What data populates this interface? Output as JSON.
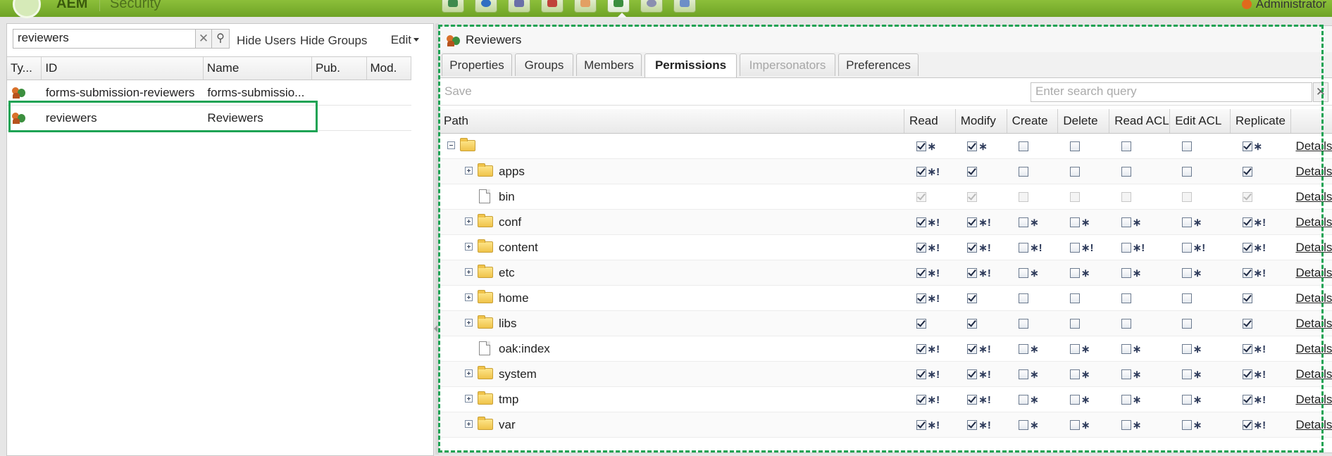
{
  "header": {
    "brand": "AEM",
    "section": "Security",
    "user": "Administrator",
    "toolbar_icons": [
      "websites-icon",
      "globe-icon",
      "dam-icon",
      "tools-icon",
      "inbox-icon",
      "users-icon",
      "workflow-icon",
      "tag-icon"
    ]
  },
  "left": {
    "search_value": "reviewers",
    "clear": "✕",
    "search_glyph": "⚲",
    "hide_users": "Hide Users",
    "hide_groups": "Hide Groups",
    "edit": "Edit",
    "columns": [
      "Ty...",
      "ID",
      "Name",
      "Pub.",
      "Mod."
    ],
    "rows": [
      {
        "id": "forms-submission-reviewers",
        "name": "forms-submissio..."
      },
      {
        "id": "reviewers",
        "name": "Reviewers"
      }
    ]
  },
  "right": {
    "title": "Reviewers",
    "tabs": [
      "Properties",
      "Groups",
      "Members",
      "Permissions",
      "Impersonators",
      "Preferences"
    ],
    "active_tab": "Permissions",
    "save": "Save",
    "search_placeholder": "Enter search query",
    "search_clear": "✕",
    "columns": [
      "Path",
      "Read",
      "Modify",
      "Create",
      "Delete",
      "Read ACL",
      "Edit ACL",
      "Replicate",
      ""
    ],
    "details_label": "Details",
    "rows": [
      {
        "path": "",
        "root": true,
        "perms": [
          [
            1,
            "∗"
          ],
          [
            1,
            "∗"
          ],
          [
            0,
            ""
          ],
          [
            0,
            ""
          ],
          [
            0,
            ""
          ],
          [
            0,
            ""
          ],
          [
            1,
            "∗"
          ]
        ]
      },
      {
        "path": "apps",
        "perms": [
          [
            1,
            "∗!"
          ],
          [
            1,
            ""
          ],
          [
            0,
            ""
          ],
          [
            0,
            ""
          ],
          [
            0,
            ""
          ],
          [
            0,
            ""
          ],
          [
            1,
            ""
          ]
        ]
      },
      {
        "path": "bin",
        "file": true,
        "disabled": true,
        "perms": [
          [
            1,
            ""
          ],
          [
            1,
            ""
          ],
          [
            0,
            ""
          ],
          [
            0,
            ""
          ],
          [
            0,
            ""
          ],
          [
            0,
            ""
          ],
          [
            1,
            ""
          ]
        ]
      },
      {
        "path": "conf",
        "perms": [
          [
            1,
            "∗!"
          ],
          [
            1,
            "∗!"
          ],
          [
            0,
            "∗"
          ],
          [
            0,
            "∗"
          ],
          [
            0,
            "∗"
          ],
          [
            0,
            "∗"
          ],
          [
            1,
            "∗!"
          ]
        ]
      },
      {
        "path": "content",
        "perms": [
          [
            1,
            "∗!"
          ],
          [
            1,
            "∗!"
          ],
          [
            0,
            "∗!"
          ],
          [
            0,
            "∗!"
          ],
          [
            0,
            "∗!"
          ],
          [
            0,
            "∗!"
          ],
          [
            1,
            "∗!"
          ]
        ]
      },
      {
        "path": "etc",
        "perms": [
          [
            1,
            "∗!"
          ],
          [
            1,
            "∗!"
          ],
          [
            0,
            "∗"
          ],
          [
            0,
            "∗"
          ],
          [
            0,
            "∗"
          ],
          [
            0,
            "∗"
          ],
          [
            1,
            "∗!"
          ]
        ]
      },
      {
        "path": "home",
        "perms": [
          [
            1,
            "∗!"
          ],
          [
            1,
            ""
          ],
          [
            0,
            ""
          ],
          [
            0,
            ""
          ],
          [
            0,
            ""
          ],
          [
            0,
            ""
          ],
          [
            1,
            ""
          ]
        ]
      },
      {
        "path": "libs",
        "perms": [
          [
            1,
            ""
          ],
          [
            1,
            ""
          ],
          [
            0,
            ""
          ],
          [
            0,
            ""
          ],
          [
            0,
            ""
          ],
          [
            0,
            ""
          ],
          [
            1,
            ""
          ]
        ]
      },
      {
        "path": "oak:index",
        "file": true,
        "perms": [
          [
            1,
            "∗!"
          ],
          [
            1,
            "∗!"
          ],
          [
            0,
            "∗"
          ],
          [
            0,
            "∗"
          ],
          [
            0,
            "∗"
          ],
          [
            0,
            "∗"
          ],
          [
            1,
            "∗!"
          ]
        ]
      },
      {
        "path": "system",
        "perms": [
          [
            1,
            "∗!"
          ],
          [
            1,
            "∗!"
          ],
          [
            0,
            "∗"
          ],
          [
            0,
            "∗"
          ],
          [
            0,
            "∗"
          ],
          [
            0,
            "∗"
          ],
          [
            1,
            "∗!"
          ]
        ]
      },
      {
        "path": "tmp",
        "perms": [
          [
            1,
            "∗!"
          ],
          [
            1,
            "∗!"
          ],
          [
            0,
            "∗"
          ],
          [
            0,
            "∗"
          ],
          [
            0,
            "∗"
          ],
          [
            0,
            "∗"
          ],
          [
            1,
            "∗!"
          ]
        ]
      },
      {
        "path": "var",
        "perms": [
          [
            1,
            "∗!"
          ],
          [
            1,
            "∗!"
          ],
          [
            0,
            "∗"
          ],
          [
            0,
            "∗"
          ],
          [
            0,
            "∗"
          ],
          [
            0,
            "∗"
          ],
          [
            1,
            "∗!"
          ]
        ]
      }
    ]
  }
}
